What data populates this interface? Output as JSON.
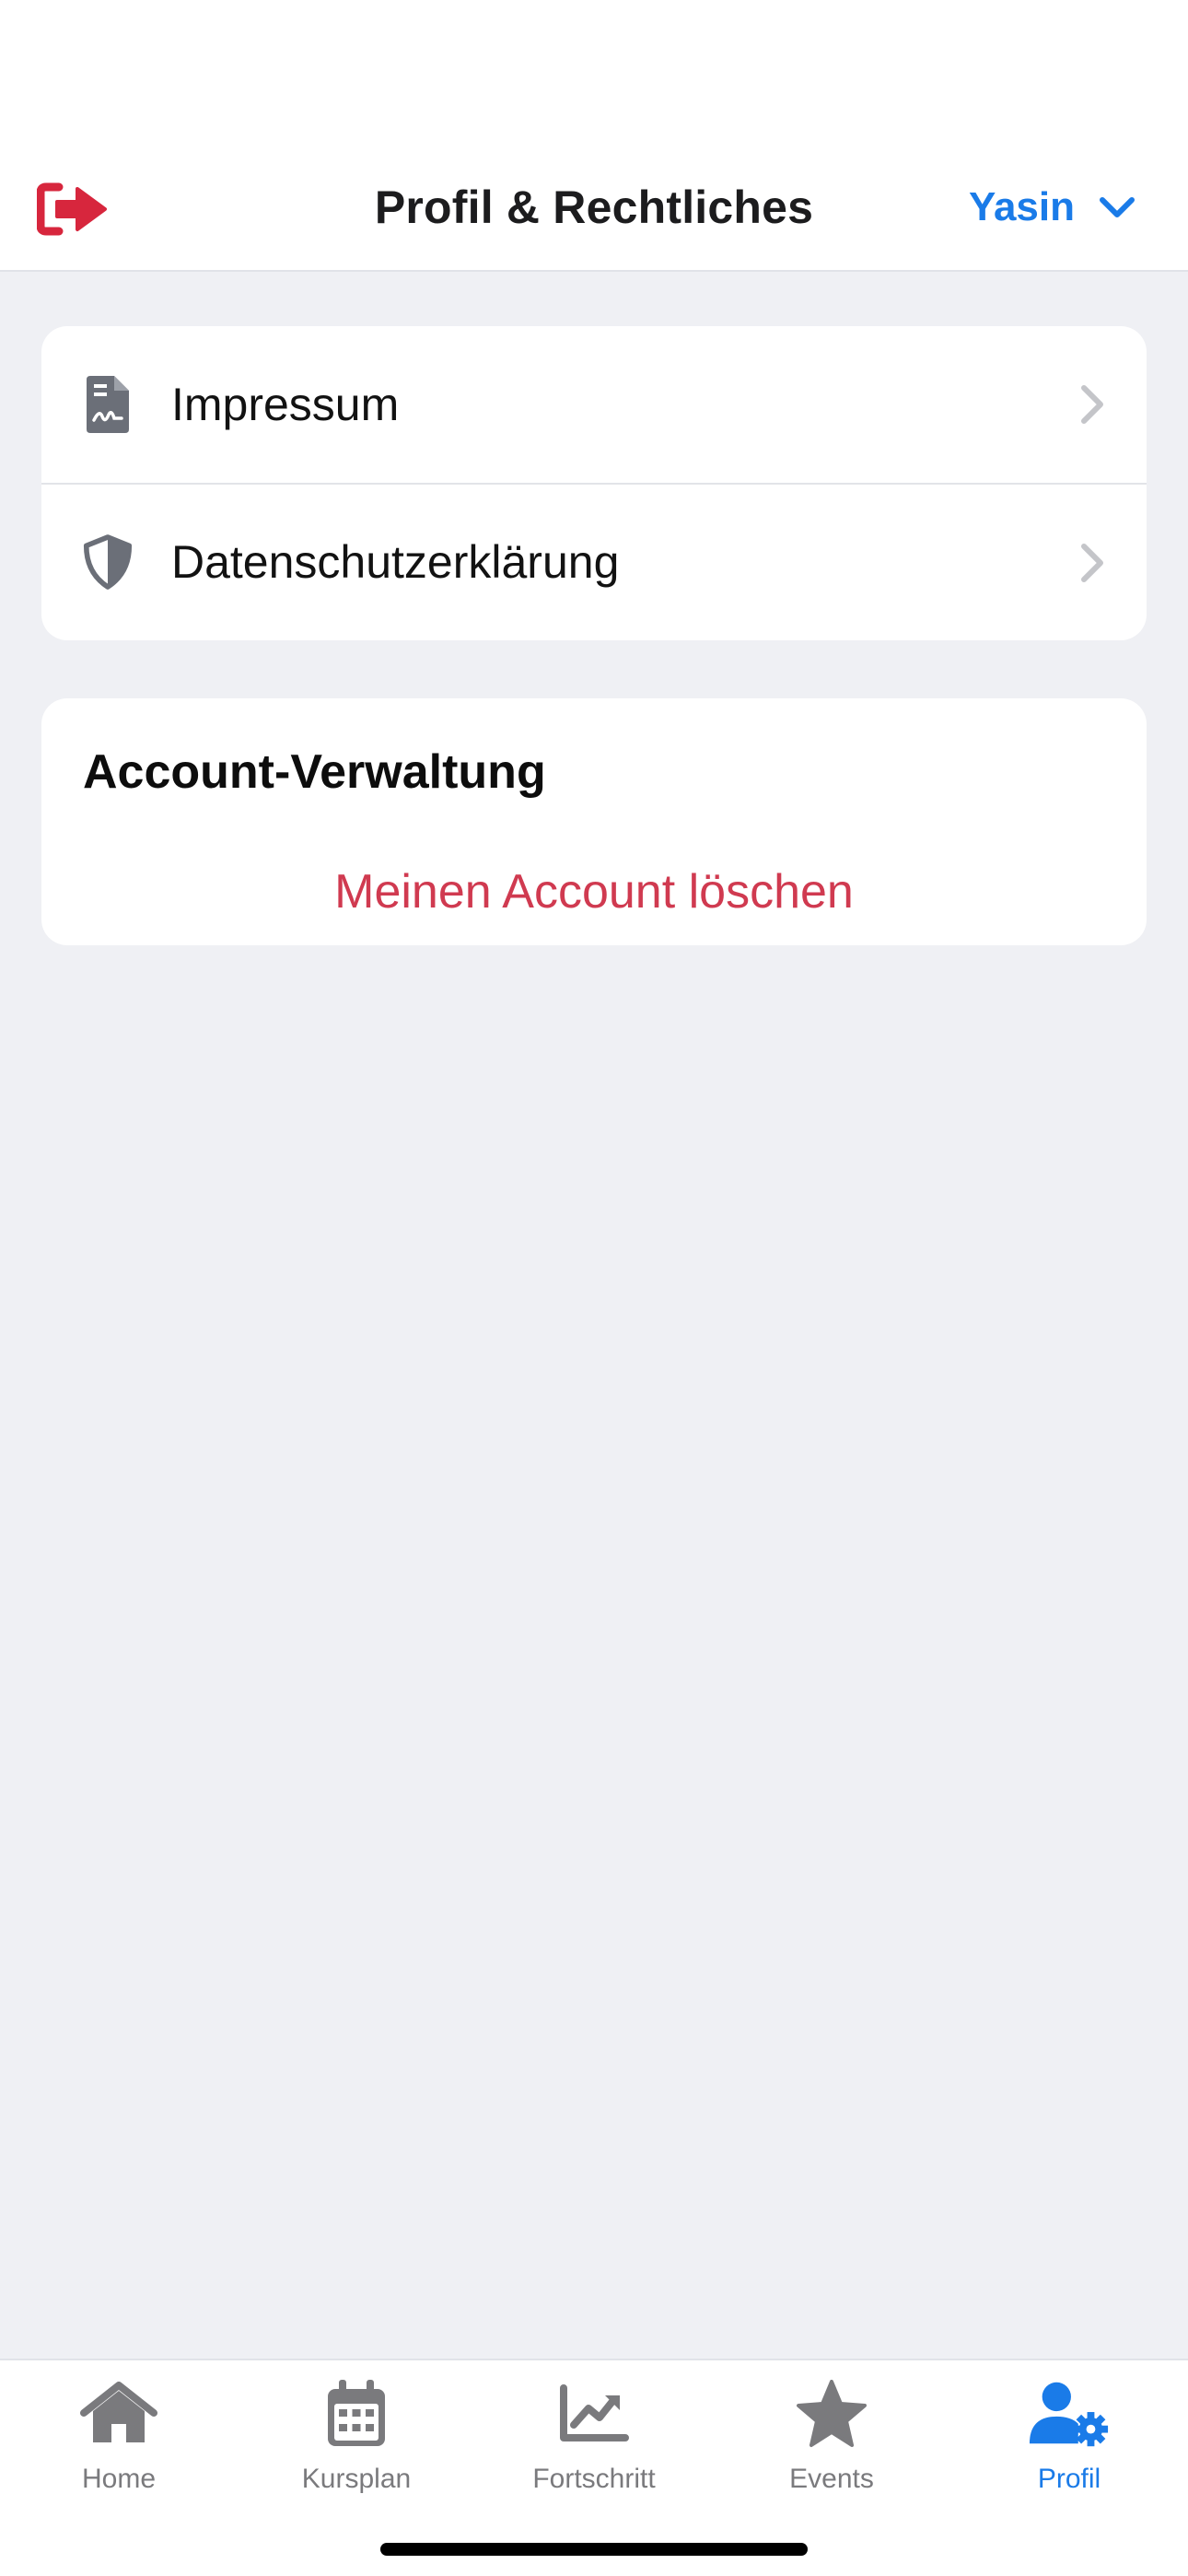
{
  "header": {
    "title": "Profil & Rechtliches",
    "user_name": "Yasin",
    "logout_icon": "sign-out-icon",
    "accent_color": "#1a7be8",
    "logout_color": "#d7263d"
  },
  "legal": {
    "items": [
      {
        "label": "Impressum",
        "icon": "file-signature-icon"
      },
      {
        "label": "Datenschutzerklärung",
        "icon": "shield-icon"
      }
    ]
  },
  "account": {
    "title": "Account-Verwaltung",
    "delete_label": "Meinen Account löschen",
    "delete_color": "#d03a50"
  },
  "tabs": [
    {
      "label": "Home",
      "icon": "home-icon",
      "active": false
    },
    {
      "label": "Kursplan",
      "icon": "calendar-icon",
      "active": false
    },
    {
      "label": "Fortschritt",
      "icon": "chart-line-icon",
      "active": false
    },
    {
      "label": "Events",
      "icon": "star-icon",
      "active": false
    },
    {
      "label": "Profil",
      "icon": "user-gear-icon",
      "active": true
    }
  ]
}
